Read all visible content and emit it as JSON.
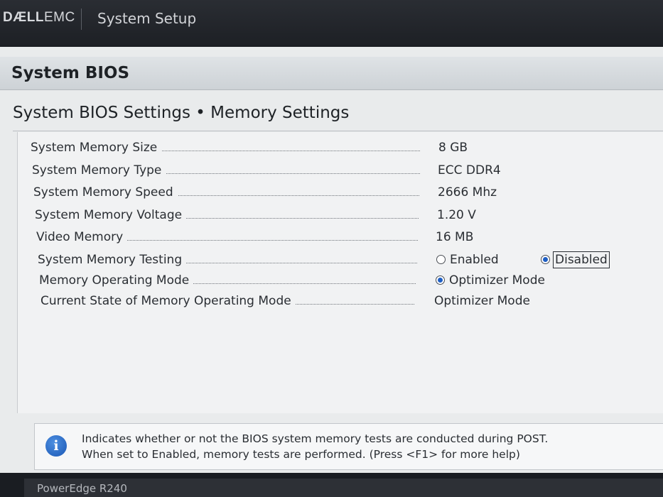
{
  "topbar": {
    "logo_part1": "DÆLL",
    "logo_part2": "EMC",
    "title": "System Setup"
  },
  "header": {
    "bios_title": "System BIOS",
    "page_title": "System BIOS Settings • Memory Settings"
  },
  "settings": [
    {
      "label": "System Memory Size",
      "value": "8 GB"
    },
    {
      "label": "System Memory Type",
      "value": "ECC DDR4"
    },
    {
      "label": "System Memory Speed",
      "value": "2666 Mhz"
    },
    {
      "label": "System Memory Voltage",
      "value": "1.20 V"
    },
    {
      "label": "Video Memory",
      "value": "16 MB"
    },
    {
      "label": "System Memory Testing",
      "options": [
        {
          "label": "Enabled",
          "selected": false
        },
        {
          "label": "Disabled",
          "selected": true
        }
      ]
    },
    {
      "label": "Memory Operating Mode",
      "options": [
        {
          "label": "Optimizer Mode",
          "selected": true
        }
      ]
    },
    {
      "label": "Current State of Memory Operating Mode",
      "value": "Optimizer Mode"
    }
  ],
  "help": {
    "line1": "Indicates whether or not the BIOS system memory tests are conducted during POST.",
    "line2": "When set to Enabled, memory tests are performed. (Press <F1> for more help)"
  },
  "footer": {
    "model": "PowerEdge R240"
  },
  "colors": {
    "accent": "#1f5fc4",
    "panel_bg": "#e9ebec",
    "topbar_bg": "#1d2025"
  }
}
